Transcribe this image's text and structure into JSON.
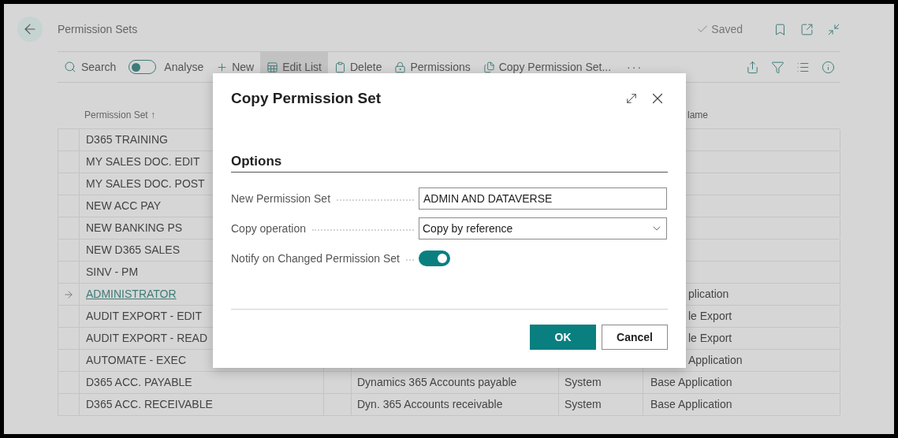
{
  "header": {
    "title": "Permission Sets",
    "status": "Saved"
  },
  "toolbar": {
    "items": [
      {
        "kind": "search",
        "label": "Search"
      },
      {
        "kind": "toggle",
        "label": "Analyse",
        "on": false
      },
      {
        "kind": "action",
        "label": "New",
        "highlighted": false
      },
      {
        "kind": "action",
        "label": "Edit List",
        "highlighted": true
      },
      {
        "kind": "action",
        "label": "Delete",
        "highlighted": false
      },
      {
        "kind": "action",
        "label": "Permissions",
        "highlighted": false
      },
      {
        "kind": "action",
        "label": "Copy Permission Set...",
        "highlighted": false
      },
      {
        "kind": "more",
        "label": "···"
      }
    ]
  },
  "table": {
    "columns": {
      "column_1": "Permission Set ↑",
      "column_5": "lame"
    },
    "rows": [
      {
        "permission_set": "D365 TRAINING",
        "current": false
      },
      {
        "permission_set": "MY SALES DOC. EDIT",
        "current": false
      },
      {
        "permission_set": "MY SALES DOC. POST",
        "current": false
      },
      {
        "permission_set": "NEW ACC PAY",
        "current": false
      },
      {
        "permission_set": "NEW BANKING PS",
        "current": false
      },
      {
        "permission_set": "NEW D365 SALES",
        "current": false
      },
      {
        "permission_set": "SINV - PM",
        "current": false
      },
      {
        "permission_set": "ADMINISTRATOR",
        "current": true,
        "extension": "plication"
      },
      {
        "permission_set": "AUDIT EXPORT - EDIT",
        "current": false,
        "extension": "le Export"
      },
      {
        "permission_set": "AUDIT EXPORT - READ",
        "current": false,
        "extension": "le Export"
      },
      {
        "permission_set": "AUTOMATE - EXEC",
        "current": false,
        "extension": "Application"
      },
      {
        "permission_set": "D365 ACC. PAYABLE",
        "current": false,
        "name": "Dynamics 365 Accounts payable",
        "scope": "System",
        "extension": "Base Application"
      },
      {
        "permission_set": "D365 ACC. RECEIVABLE",
        "current": false,
        "name": "Dyn. 365 Accounts receivable",
        "scope": "System",
        "extension": "Base Application"
      }
    ]
  },
  "dialog": {
    "title": "Copy Permission Set",
    "section": "Options",
    "fields": [
      {
        "kind": "text",
        "label": "New Permission Set",
        "value": "ADMIN AND DATAVERSE"
      },
      {
        "kind": "select",
        "label": "Copy operation",
        "value": "Copy by reference"
      },
      {
        "kind": "toggle",
        "label": "Notify on Changed Permission Set",
        "on": true
      }
    ],
    "buttons": [
      {
        "label": "OK",
        "primary": true
      },
      {
        "label": "Cancel",
        "primary": false
      }
    ]
  }
}
